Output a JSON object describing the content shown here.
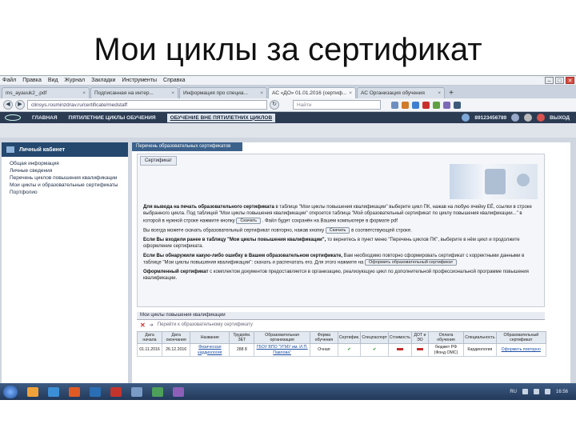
{
  "slide": {
    "title": "Мои циклы за сертификат"
  },
  "browser": {
    "menu": [
      "Файл",
      "Правка",
      "Вид",
      "Журнал",
      "Закладки",
      "Инструменты",
      "Справка"
    ],
    "window_controls": [
      "–",
      "□",
      "✕"
    ],
    "tabs": [
      {
        "label": "ms_ayauuk2_.pdf"
      },
      {
        "label": "Подписанная на интер..."
      },
      {
        "label": "Информация про специа..."
      },
      {
        "label": "АС «ДО» 01.01.2016 (сертиф..."
      },
      {
        "label": "АС Организация обучения"
      }
    ],
    "new_tab": "+",
    "url": "clinsys.rosminzdrav.ru/certificate/medstaff",
    "search_placeholder": "Найти",
    "nav": {
      "back": "◀",
      "forward": "▶",
      "reload": "↻"
    }
  },
  "site": {
    "nav": [
      "ГЛАВНАЯ",
      "ПЯТИЛЕТНИЕ ЦИКЛЫ ОБУЧЕНИЯ",
      "ОБУЧЕНИЕ ВНЕ ПЯТИЛЕТНИХ ЦИКЛОВ"
    ],
    "phone": "89123456789",
    "logout": "ВЫХОД"
  },
  "sidebar": {
    "title": "Личный кабинет",
    "items": [
      "Общая информация",
      "Личные сведения",
      "Перечень циклов повышения квалификации",
      "Мои циклы и образовательные сертификаты",
      "Портфолио"
    ]
  },
  "content": {
    "section_tab": "Перечень образовательных сертификатов",
    "inner_tab": "Сертификат",
    "paragraphs": {
      "p1_bold": "Для вывода на печать образовательного сертификата",
      "p1_rest": "в таблице \"Мои циклы повышения квалификации\" выберите цикл ПК, нажав на любую ячейку ЕЁ, ссылки в строке выбранного цикла. Под таблицей \"Мои циклы повышения квалификации\" откроется таблица \"Мой образовательный сертификат по циклу повышения квалификации...\" в которой в нужной строке нажмите кнопку",
      "p1_end": ". Файл будет сохранён на Вашем компьютере в формате pdf",
      "p2_start": "Вы всегда можете скачать образовательный сертификат повторно, нажав кнопку",
      "p2_end": "в соответствующей строке.",
      "p3_bold": "Если Вы входили ранее в таблицу \"Мои циклы повышения квалификации\",",
      "p3_rest": "то вернитесь в пункт меню \"Перечень циклов ПК\", выберите в нём цикл и продолжите оформление сертификата.",
      "p4_bold": "Если Вы обнаружили какую-либо ошибку в Вашем образовательном сертификате,",
      "p4_rest": "Вам необходимо повторно сформировать сертификат с корректными данными в таблице \"Мои циклы повышения квалификации\": скачать и распечатать его. Для этого нажмите на",
      "p5_bold": "Оформленный сертификат",
      "p5_rest": "с комплектом документов предоставляется в организацию, реализующую цикл по дополнительной профессиональной программе повышения квалификации."
    },
    "buttons": {
      "download": "Скачать",
      "regenerate": "Оформить образовательный сертификат"
    }
  },
  "cycles": {
    "title": "Мои циклы повышения квалификации",
    "toolbar_text": "Перейти к образовательному сертификату",
    "columns": [
      "Дата начала",
      "Дата окончания",
      "Название",
      "Трудоём. ЗЕТ",
      "Образовательная организация",
      "Форма обучения",
      "Сертифик.",
      "Спецпаспорт",
      "Стоимость",
      "ДОТ и ЭО",
      "Оплата обучения",
      "Специальность",
      "Образовательный сертификат"
    ],
    "rows": [
      {
        "start": "01.11.2016",
        "end": "26.12.2016",
        "name": "Физическая кардиология",
        "hours": "288 8",
        "org": "ГБОУ ВПО \"УГМУ им. И.П. Павлова\"",
        "form": "Очная",
        "cert": "✔",
        "passport": "✔",
        "cost": "",
        "dot": "",
        "payment": "бюджет РФ (Фонд ОМС)",
        "specialty": "Кардиология",
        "action": "Оформить повторно"
      }
    ]
  },
  "taskbar": {
    "lang": "RU",
    "time": "16:56"
  },
  "colors": {
    "site_nav": "#2b3b52",
    "sidebar_head": "#24486e",
    "accent_link": "#1c4fa3",
    "error_mark": "#c62b2b",
    "ok_mark": "#3a9a3a"
  }
}
